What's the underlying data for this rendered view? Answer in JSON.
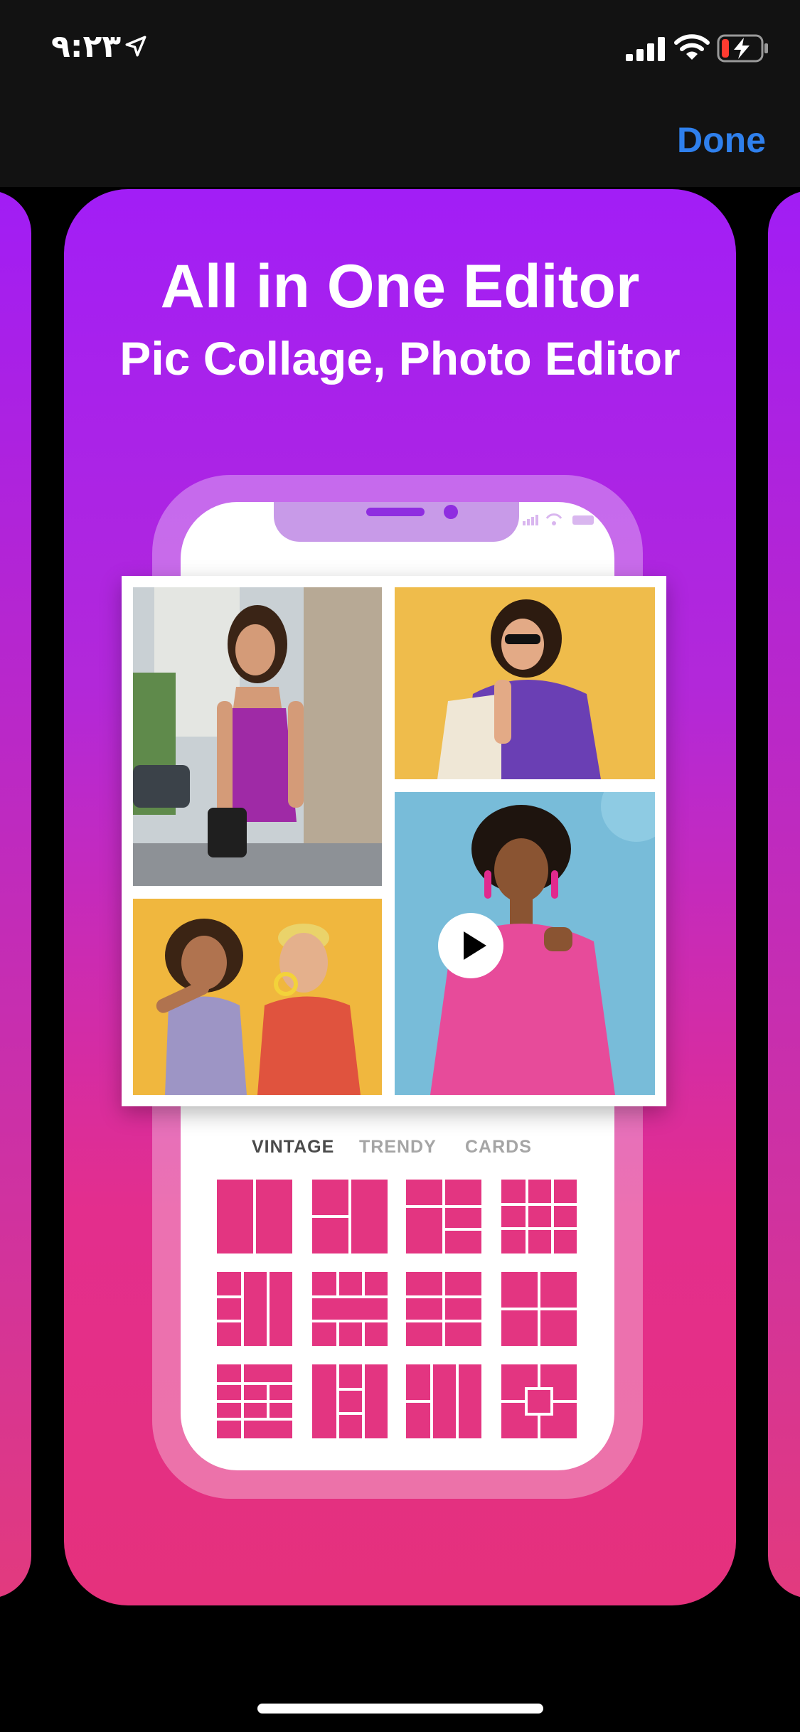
{
  "status_bar": {
    "time": "٩:٢٣"
  },
  "nav": {
    "done_label": "Done"
  },
  "card": {
    "headline": "All in One Editor",
    "subline": "Pic Collage, Photo Editor"
  },
  "collage": {
    "photos": [
      "woman-in-purple-dress-photo",
      "woman-with-sunglasses-photo",
      "couple-smiling-photo",
      "woman-in-pink-photo"
    ]
  },
  "tabs": [
    "VINTAGE",
    "TRENDY",
    "CARDS"
  ],
  "layout_tiles": 12,
  "colors": {
    "accent": "#2f80ed",
    "card_top": "#a21ef6",
    "card_bottom": "#e5317c",
    "tile": "#e33581"
  }
}
